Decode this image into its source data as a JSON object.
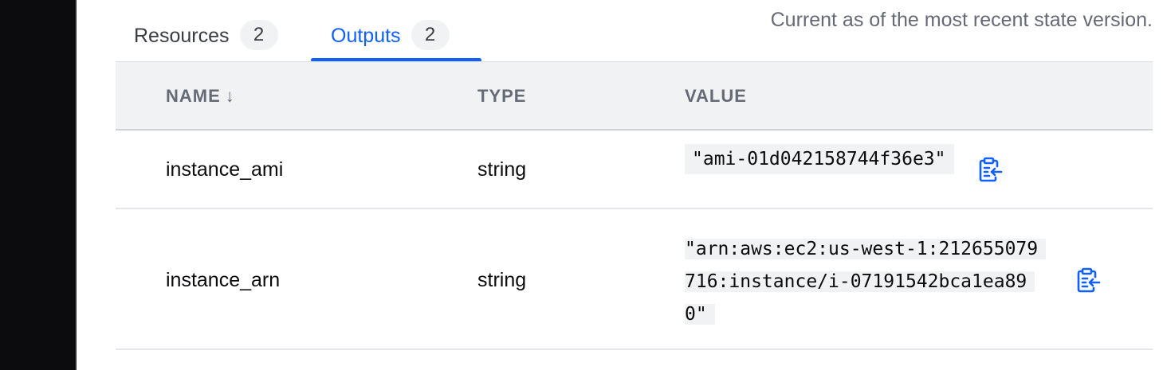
{
  "tabs": [
    {
      "label": "Resources",
      "count": "2",
      "active": false
    },
    {
      "label": "Outputs",
      "count": "2",
      "active": true
    }
  ],
  "state_note": "Current as of the most recent state version.",
  "table": {
    "headers": {
      "name": "NAME",
      "name_sort_icon": "arrow-down-icon",
      "type": "TYPE",
      "value": "VALUE"
    },
    "rows": [
      {
        "name": "instance_ami",
        "type": "string",
        "value_lines": [
          "\"ami-01d042158744f36e3\""
        ],
        "copy_icon": "clipboard-copy-icon"
      },
      {
        "name": "instance_arn",
        "type": "string",
        "value_lines": [
          "\"arn:aws:ec2:us-west-1:212655079",
          "716:instance/i-07191542bca1ea89",
          "0\""
        ],
        "copy_icon": "clipboard-copy-icon"
      }
    ]
  },
  "colors": {
    "accent": "#1060ff",
    "header_bg": "#f1f2f3",
    "sidebar": "#0c0c0e",
    "muted_text": "#656a76"
  }
}
